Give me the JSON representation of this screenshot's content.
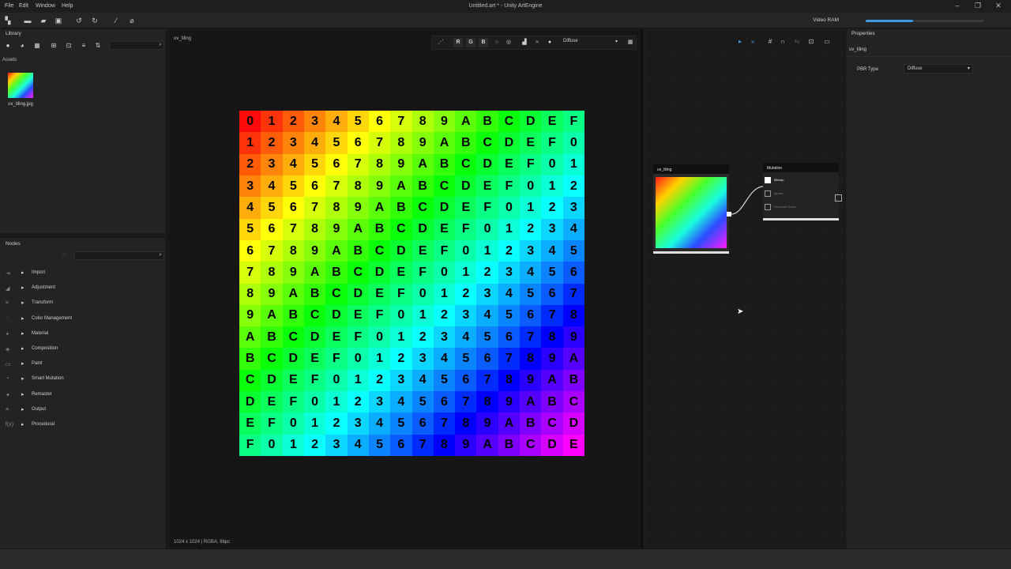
{
  "menu": {
    "file": "File",
    "edit": "Edit",
    "window": "Window",
    "help": "Help"
  },
  "window_title": "Untitled.art * - Unity ArtEngine",
  "window_controls": {
    "minimize": "–",
    "maximize": "❐",
    "close": "✕"
  },
  "toolbar": {
    "icons": [
      "app-icon",
      "new-icon",
      "open-icon",
      "save-icon",
      "undo-icon",
      "redo-icon",
      "brush-icon",
      "eraser-icon"
    ],
    "video_ram_label": "Video RAM",
    "video_ram_fraction": 0.4
  },
  "library": {
    "title": "Library",
    "assets_label": "Assets",
    "asset": {
      "name": "uv_tiling.jpg"
    }
  },
  "nodes_panel": {
    "title": "Nodes",
    "categories": [
      {
        "label": "Import",
        "icon": "⇥"
      },
      {
        "label": "Adjustment",
        "icon": "◢"
      },
      {
        "label": "Transform",
        "icon": "⌗"
      },
      {
        "label": "Color Management",
        "icon": "◌"
      },
      {
        "label": "Material",
        "icon": "◕"
      },
      {
        "label": "Composition",
        "icon": "◈"
      },
      {
        "label": "Paint",
        "icon": "▭"
      },
      {
        "label": "Smart Mutation",
        "icon": "◔"
      },
      {
        "label": "Remaster",
        "icon": "✦"
      },
      {
        "label": "Output",
        "icon": "≡"
      },
      {
        "label": "Procedural",
        "icon": "f(x)"
      }
    ]
  },
  "viewer": {
    "tab": "uv_tiling",
    "channels": {
      "r": "R",
      "g": "G",
      "b": "B"
    },
    "display_mode": "Diffuse",
    "status": "1024 x 1024 | RGBA, 8bpc",
    "uv_rows": [
      "0123456789ABCDEF",
      "123456789ABCDEF0",
      "23456789ABCDEF01",
      "3456789ABCDEF012",
      "456789ABCDEF0123",
      "56789ABCDEF01234",
      "6789ABCDEF012345",
      "789ABCDEF0123456",
      "89ABCDEF01234567",
      "9ABCDEF012345678",
      "ABCDEF0123456789",
      "BCDEF0123456789A",
      "CDEF0123456789AB",
      "DEF0123456789ABC",
      "EF0123456789ABCD",
      "F0123456789ABCDE"
    ]
  },
  "graph": {
    "source_node": {
      "title": "uv_tiling"
    },
    "mutation_node": {
      "title": "Mutation",
      "ports": [
        {
          "label": "Bitmap",
          "active": true
        },
        {
          "label": "Ignore",
          "active": false
        },
        {
          "label": "Structure Guide",
          "active": false
        }
      ]
    }
  },
  "properties": {
    "title": "Properties",
    "selected_node": "uv_tiling",
    "pbr_type_label": "PBR Type",
    "pbr_type_value": "Diffuse"
  }
}
